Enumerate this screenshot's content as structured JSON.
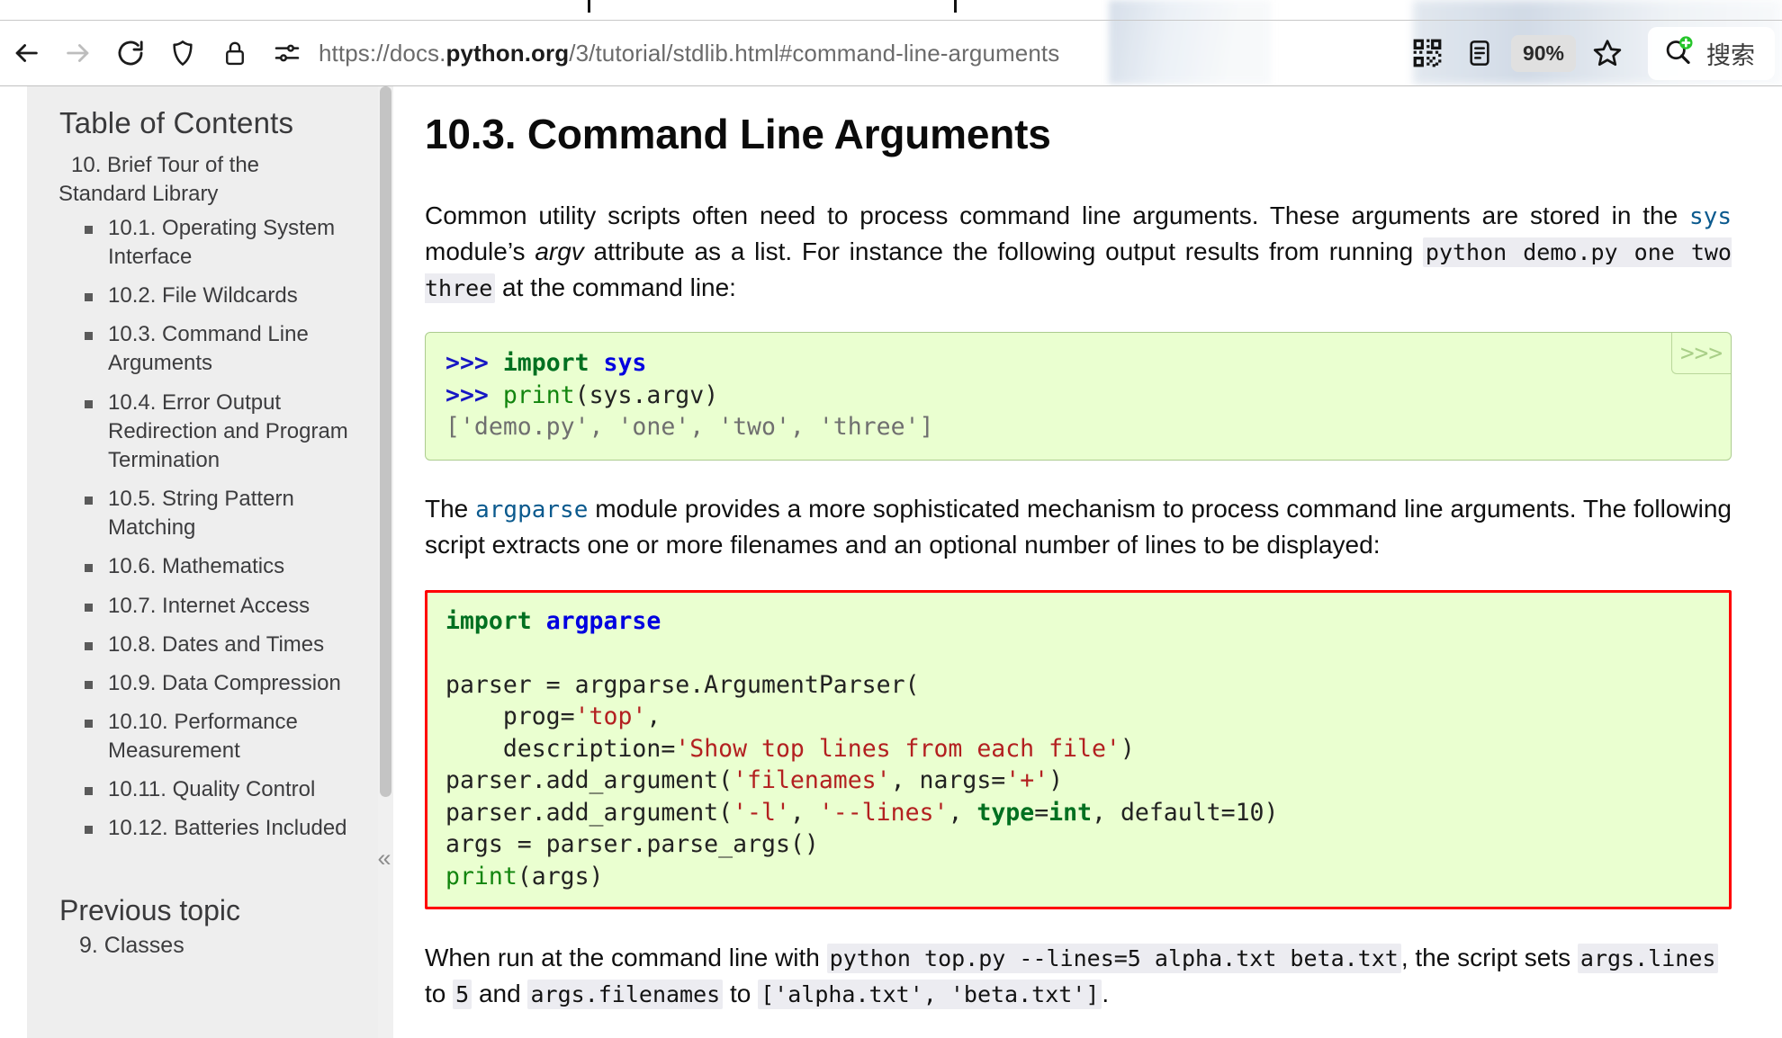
{
  "browser": {
    "back_label": "Back",
    "forward_label": "Forward",
    "reload_label": "Reload",
    "shield_label": "Tracking Protection",
    "lock_label": "Connection Secure",
    "permissions_label": "Site Permissions",
    "url_prefix": "https://docs.",
    "url_domain": "python.org",
    "url_suffix": "/3/tutorial/stdlib.html#command-line-arguments",
    "url_full": "https://docs.python.org/3/tutorial/stdlib.html#command-line-arguments",
    "qr_label": "QR Code",
    "reader_label": "Reader View",
    "zoom_level": "90%",
    "bookmark_label": "Bookmark",
    "search_label": "搜索"
  },
  "sidebar": {
    "toc_title": "Table of Contents",
    "chapter_line1": "10. Brief Tour of the",
    "chapter_line2": "Standard Library",
    "items": [
      {
        "label": "10.1. Operating System Interface"
      },
      {
        "label": "10.2. File Wildcards"
      },
      {
        "label": "10.3. Command Line Arguments"
      },
      {
        "label": "10.4. Error Output Redirection and Program Termination"
      },
      {
        "label": "10.5. String Pattern Matching"
      },
      {
        "label": "10.6. Mathematics"
      },
      {
        "label": "10.7. Internet Access"
      },
      {
        "label": "10.8. Dates and Times"
      },
      {
        "label": "10.9. Data Compression"
      },
      {
        "label": "10.10. Performance Measurement"
      },
      {
        "label": "10.11. Quality Control"
      },
      {
        "label": "10.12. Batteries Included"
      }
    ],
    "previous_topic_title": "Previous topic",
    "previous_topic_link": "9. Classes",
    "collapse_glyph": "«"
  },
  "main": {
    "heading": "10.3. Command Line Arguments",
    "p1_a": "Common utility scripts often need to process command line arguments. These arguments are stored in the ",
    "p1_sys": "sys",
    "p1_b": " module’s ",
    "p1_argv": "argv",
    "p1_c": " attribute as a list. For instance the following output results from running ",
    "p1_cmd": "python demo.py one two three",
    "p1_d": " at the command line:",
    "code1": {
      "copy_glyph": ">>>",
      "l1_prompt": ">>> ",
      "l1_kw": "import",
      "l1_mod": " sys",
      "l2_prompt": ">>> ",
      "l2_fn": "print",
      "l2_rest": "(sys.argv)",
      "l3_out": "['demo.py', 'one', 'two', 'three']"
    },
    "p2_a": "The ",
    "p2_argparse": "argparse",
    "p2_b": " module provides a more sophisticated mechanism to process command line arguments. The following script extracts one or more filenames and an optional number of lines to be displayed:",
    "code2": {
      "l1_kw": "import",
      "l1_mod": " argparse",
      "l3": "parser = argparse.ArgumentParser(",
      "l4_pre": "    prog=",
      "l4_str": "'top'",
      "l4_post": ",",
      "l5_pre": "    description=",
      "l5_str": "'Show top lines from each file'",
      "l5_post": ")",
      "l6_pre": "parser.add_argument(",
      "l6_str1": "'filenames'",
      "l6_mid": ", nargs=",
      "l6_str2": "'+'",
      "l6_post": ")",
      "l7_pre": "parser.add_argument(",
      "l7_str1": "'-l'",
      "l7_mid1": ", ",
      "l7_str2": "'--lines'",
      "l7_mid2": ", ",
      "l7_kw": "type",
      "l7_mid3": "=",
      "l7_int": "int",
      "l7_mid4": ", default=",
      "l7_num": "10",
      "l7_post": ")",
      "l8": "args = parser.parse_args()",
      "l9_fn": "print",
      "l9_rest": "(args)"
    },
    "p3_a": "When run at the command line with ",
    "p3_cmd": "python top.py --lines=5 alpha.txt beta.txt",
    "p3_b": ", the script sets ",
    "p3_c1": "args.lines",
    "p3_c": " to ",
    "p3_c2": "5",
    "p3_d": " and ",
    "p3_c3": "args.filenames",
    "p3_e": " to ",
    "p3_c4": "['alpha.txt', 'beta.txt']",
    "p3_f": "."
  },
  "colors": {
    "code_bg": "#eaffd0",
    "code_border": "#accc8f",
    "flag_border": "#ff0000",
    "sidebar_bg": "#eeeeee",
    "link": "#0b5a8e",
    "string": "#b32020",
    "keyword": "#007020",
    "module": "#0000e0",
    "prompt": "#1616c4"
  }
}
